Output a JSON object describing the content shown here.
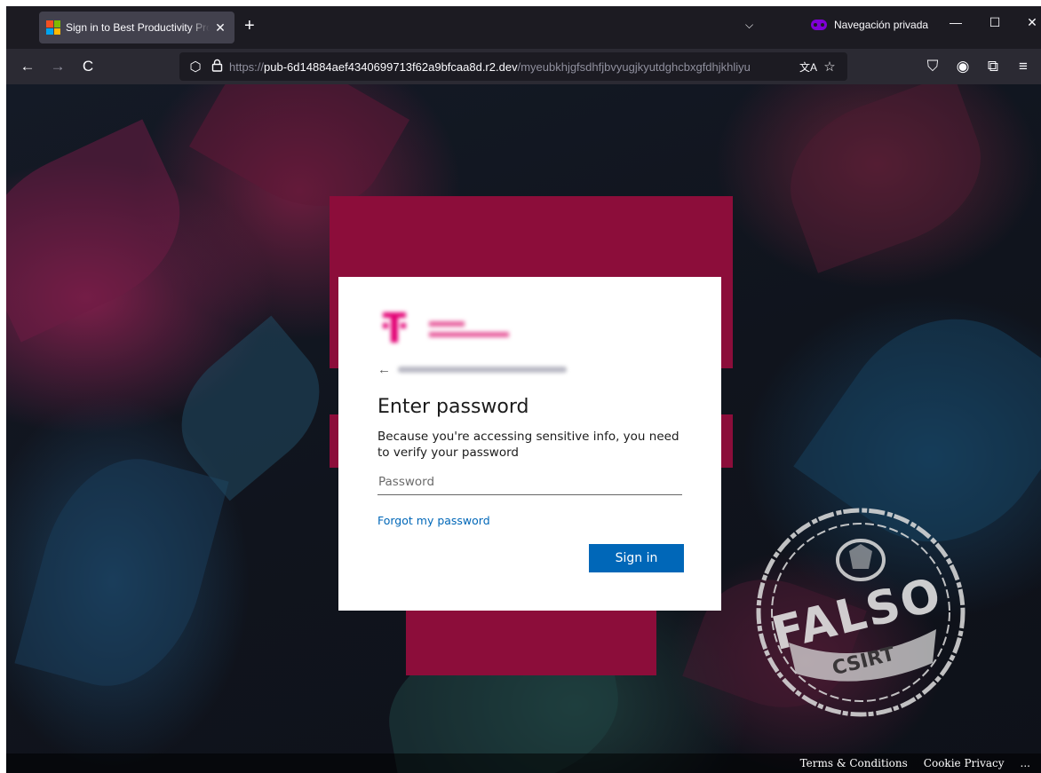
{
  "browser": {
    "tab_title": "Sign in to Best Productivity Products",
    "tab_close": "✕",
    "new_tab": "+",
    "tab_list_icon": "chevron-down-icon",
    "tab_list_glyph": "⌵",
    "private_label": "Navegación privada",
    "window_controls": {
      "minimize": "—",
      "maximize": "☐",
      "close": "✕"
    },
    "url": {
      "scheme": "https://",
      "host": "pub-6d14884aef4340699713f62a9bfcaa8d.r2.dev",
      "path": "/myeubkhjgfsdhfjbvyugjkyutdghcbxgfdhjkhliyu"
    },
    "nav": {
      "back": "←",
      "forward": "→",
      "reload": "C"
    },
    "url_icons": {
      "shield": "⬡",
      "lock": "🔒",
      "translate": "文A",
      "bookmark": "☆"
    },
    "toolbar_icons": {
      "pocket": "⛉",
      "account": "◉",
      "extensions": "⧉",
      "menu": "≡"
    },
    "colors": {
      "tab_bg": "#42414d",
      "navbar_bg": "#2b2a33",
      "titlebar_bg": "#1c1b22",
      "private_purple": "#8000d7"
    }
  },
  "login": {
    "heading": "Enter password",
    "description": "Because you're accessing sensitive info, you need to verify your password",
    "password_placeholder": "Password",
    "forgot_link": "Forgot my password",
    "signin_button": "Sign in",
    "back_arrow": "←",
    "colors": {
      "primary": "#0067b8",
      "brand_magenta": "#e20074",
      "background_t": "#8c0d3a"
    }
  },
  "footer": {
    "terms": "Terms & Conditions",
    "cookie": "Cookie Privacy",
    "more": "..."
  },
  "stamp": {
    "word": "FALSO",
    "org": "CSIRT"
  }
}
